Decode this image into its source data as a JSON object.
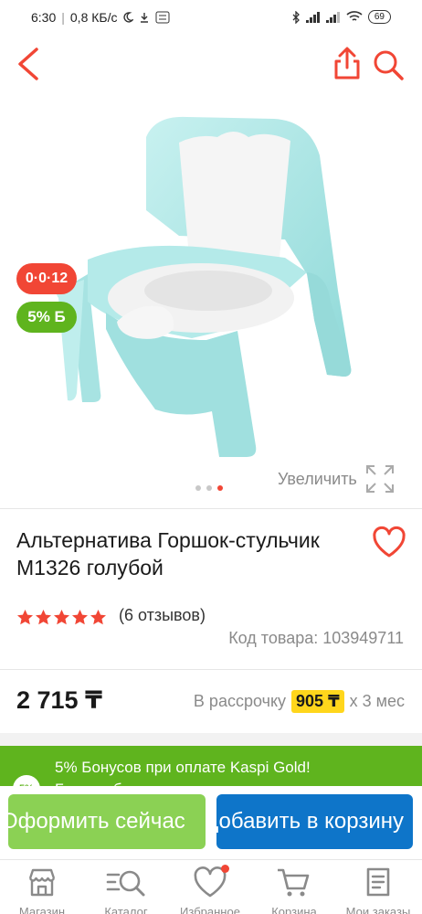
{
  "status_bar": {
    "time": "6:30",
    "network_speed": "0,8 КБ/с",
    "battery": "69"
  },
  "colors": {
    "accent": "#f14635",
    "bonus_green": "#5fb41e",
    "buy_green": "#8bd154",
    "cart_blue": "#0e75c9",
    "installment_yellow": "#ffd61c"
  },
  "header": {
    "back_icon": "chevron-left-icon",
    "share_icon": "share-icon",
    "search_icon": "search-icon"
  },
  "gallery": {
    "age_badge": "0·0·12",
    "bonus_badge": "5% Б",
    "zoom_label": "Увеличить",
    "slide_count": 3,
    "active_slide": 3
  },
  "product": {
    "title": "Альтернатива Горшок-стульчик М1326 голубой",
    "rating": 5,
    "reviews": "(6 отзывов)",
    "sku": "Код товара: 103949711",
    "price": "2 715 ₸"
  },
  "installment": {
    "prefix": "В рассрочку",
    "monthly": "905 ₸",
    "suffix": "х 3 мес"
  },
  "bonus_banner": {
    "line1": "5% Бонусов при оплате Kaspi Gold!",
    "line2": "Бонусы будут начислены после",
    "icon_text": "5%"
  },
  "actions": {
    "buy_now": "Оформить сейчас",
    "add_to_cart": "Добавить в корзину"
  },
  "nav": [
    {
      "label": "Магазин",
      "icon": "store-icon"
    },
    {
      "label": "Каталог",
      "icon": "catalog-search-icon"
    },
    {
      "label": "Избранное",
      "icon": "heart-icon"
    },
    {
      "label": "Корзина",
      "icon": "cart-icon"
    },
    {
      "label": "Мои заказы",
      "icon": "orders-icon"
    }
  ]
}
